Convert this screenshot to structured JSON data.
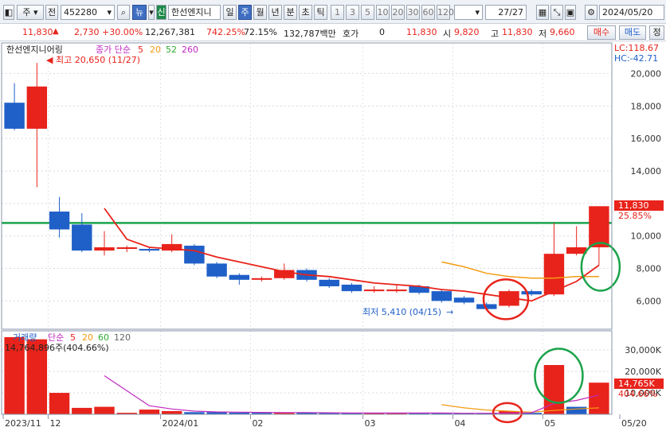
{
  "toolbar": {
    "period_type": "주",
    "market": "전",
    "code": "452280",
    "new_label": "뉴",
    "credit_label": "신",
    "stock_name": "한선엔지니",
    "period_tabs": [
      "일",
      "주",
      "월",
      "년",
      "분",
      "초",
      "틱"
    ],
    "active_tab": "주",
    "intervals": [
      "1",
      "3",
      "5",
      "10",
      "20",
      "30",
      "60",
      "120"
    ],
    "count": "27/27",
    "date": "2024/05/20"
  },
  "quote": {
    "price": "11,830",
    "change": "2,730 +30.00%",
    "volume": "12,267,381",
    "vol_ratio": "742.25%",
    "turnover": "72.15%",
    "amount": "132,787백만",
    "hoga_label": "호가",
    "hoga_value": "0",
    "ask": "11,830",
    "open_label": "시",
    "open": "9,820",
    "high_label": "고",
    "high": "11,830",
    "low_label": "저",
    "low": "9,660",
    "buy_label": "매수",
    "sell_label": "매도",
    "edit_label": "정"
  },
  "price_panel": {
    "title": "한선엔지니어링",
    "ma_label": "종가 단순",
    "ma_periods": [
      "5",
      "20",
      "52",
      "260"
    ],
    "lc": "LC:118.67",
    "hc": "HC:-42.71",
    "high_note": "최고 20,650 (11/27)",
    "low_note": "최저 5,410 (04/15)",
    "last_price_tag": "11,830",
    "last_change_tag": "25.85%"
  },
  "volume_panel": {
    "title": "거래량",
    "ma_label": "단순",
    "ma_periods": [
      "5",
      "20",
      "60",
      "120"
    ],
    "vol_note": "14,764,896주(404.66%)",
    "last_vol_tag": "14,765K",
    "last_pct_tag": "404.66%"
  },
  "x_labels": [
    "2023/11",
    "12",
    "2024/01",
    "02",
    "03",
    "04",
    "05",
    "05/20"
  ],
  "colors": {
    "up": "#e8231b",
    "down": "#1f5fc8",
    "ma5": "#e8231b",
    "ma20": "#f39c12",
    "ma52": "#2eaa2e",
    "ma260": "#c02ac0",
    "hline": "#1aa34a",
    "circle_red": "#e8231b",
    "circle_green": "#1aa34a"
  },
  "chart_data": [
    {
      "type": "candlestick",
      "y_ticks": [
        6000,
        8000,
        10000,
        12000,
        14000,
        16000,
        18000,
        20000
      ],
      "ylim": [
        4600,
        21000
      ],
      "horizontal_line": 10800,
      "candles": [
        {
          "o": 18200,
          "h": 19400,
          "l": 16500,
          "c": 16600
        },
        {
          "o": 16600,
          "h": 20650,
          "l": 13000,
          "c": 19200
        },
        {
          "o": 11500,
          "h": 12400,
          "l": 9900,
          "c": 10400
        },
        {
          "o": 10700,
          "h": 11400,
          "l": 9000,
          "c": 9100
        },
        {
          "o": 9100,
          "h": 10300,
          "l": 8800,
          "c": 9300
        },
        {
          "o": 9200,
          "h": 9400,
          "l": 9000,
          "c": 9300
        },
        {
          "o": 9200,
          "h": 9300,
          "l": 9000,
          "c": 9100
        },
        {
          "o": 9100,
          "h": 10100,
          "l": 9000,
          "c": 9500
        },
        {
          "o": 9400,
          "h": 9500,
          "l": 8200,
          "c": 8300
        },
        {
          "o": 8300,
          "h": 8400,
          "l": 7400,
          "c": 7500
        },
        {
          "o": 7600,
          "h": 7700,
          "l": 7000,
          "c": 7300
        },
        {
          "o": 7300,
          "h": 7500,
          "l": 7200,
          "c": 7400
        },
        {
          "o": 7400,
          "h": 8300,
          "l": 7300,
          "c": 7900
        },
        {
          "o": 7900,
          "h": 8000,
          "l": 7200,
          "c": 7300
        },
        {
          "o": 7300,
          "h": 7400,
          "l": 6800,
          "c": 6900
        },
        {
          "o": 7000,
          "h": 7100,
          "l": 6500,
          "c": 6600
        },
        {
          "o": 6600,
          "h": 6900,
          "l": 6500,
          "c": 6700
        },
        {
          "o": 6600,
          "h": 7000,
          "l": 6500,
          "c": 6700
        },
        {
          "o": 6900,
          "h": 7000,
          "l": 6400,
          "c": 6500
        },
        {
          "o": 6600,
          "h": 6700,
          "l": 5900,
          "c": 6000
        },
        {
          "o": 6200,
          "h": 6300,
          "l": 5800,
          "c": 5900
        },
        {
          "o": 5800,
          "h": 5900,
          "l": 5410,
          "c": 5500
        },
        {
          "o": 5700,
          "h": 6700,
          "l": 5600,
          "c": 6600
        },
        {
          "o": 6600,
          "h": 6700,
          "l": 6300,
          "c": 6400
        },
        {
          "o": 6400,
          "h": 10800,
          "l": 6300,
          "c": 8900
        },
        {
          "o": 8900,
          "h": 10600,
          "l": 8800,
          "c": 9300
        },
        {
          "o": 9300,
          "h": 11830,
          "l": 8200,
          "c": 11830
        }
      ],
      "ma5": [
        null,
        null,
        null,
        null,
        11700,
        9800,
        9300,
        9200,
        9100,
        8700,
        8400,
        8100,
        7800,
        7600,
        7500,
        7300,
        7100,
        7000,
        6900,
        6700,
        6600,
        6400,
        6200,
        6000,
        6600,
        7200,
        8200
      ],
      "ma20": [
        null,
        null,
        null,
        null,
        null,
        null,
        null,
        null,
        null,
        null,
        null,
        null,
        null,
        null,
        null,
        null,
        null,
        null,
        null,
        8400,
        8100,
        7700,
        7500,
        7400,
        7400,
        7500,
        7500
      ]
    },
    {
      "type": "bar",
      "series_name": "거래량",
      "y_ticks": [
        10000,
        20000,
        30000
      ],
      "ylim": [
        0,
        36000
      ],
      "values": [
        36000,
        35000,
        10000,
        3000,
        3500,
        700,
        2200,
        1500,
        1000,
        1000,
        800,
        700,
        700,
        800,
        600,
        600,
        500,
        600,
        500,
        600,
        500,
        400,
        1500,
        700,
        23000,
        3500,
        14765
      ],
      "up": [
        true,
        true,
        true,
        true,
        true,
        true,
        true,
        true,
        false,
        false,
        false,
        false,
        true,
        false,
        false,
        false,
        true,
        true,
        false,
        false,
        false,
        false,
        true,
        false,
        true,
        false,
        true
      ],
      "ma5": [
        null,
        null,
        null,
        null,
        18000,
        11000,
        4000,
        2500,
        1500,
        1100,
        1000,
        900,
        800,
        800,
        700,
        600,
        600,
        600,
        600,
        600,
        500,
        500,
        600,
        700,
        5000,
        6500,
        9000
      ],
      "ma20": [
        null,
        null,
        null,
        null,
        null,
        null,
        null,
        null,
        null,
        null,
        null,
        null,
        null,
        null,
        null,
        null,
        null,
        null,
        null,
        4500,
        3000,
        2000,
        1500,
        1000,
        1800,
        2500,
        3000
      ]
    }
  ]
}
